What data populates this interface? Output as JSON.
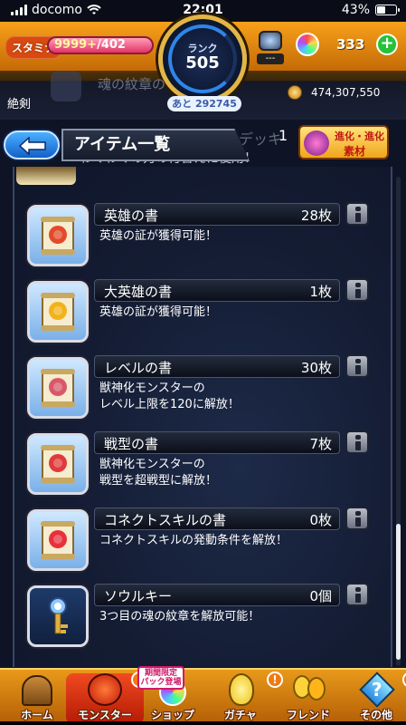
{
  "status_bar": {
    "carrier": "docomo",
    "time": "22:01",
    "battery": "43%",
    "battery_level": 0.43
  },
  "header": {
    "stamina_label": "スタミナ",
    "stamina_current": "9999+",
    "stamina_max": "/402",
    "rank_label": "ランク",
    "rank_value": "505",
    "rank_next": "あと 292745",
    "item_slot_label": "---",
    "orb_count": "333",
    "plus_label": "+",
    "title_left": "絶剣",
    "gold": "474,307,550",
    "faded_text": "魂の紋章の"
  },
  "banner": {
    "title": "アイテム一覧",
    "behind_text": "ワクワクデッキ",
    "behind_subtext": "わくわくの力の付替えに使用！",
    "behind_count": "1",
    "evo_line1": "進化・進化",
    "evo_line2": "素材"
  },
  "items": [
    {
      "name": "英雄の書",
      "count": "28枚",
      "description": "英雄の証が獲得可能！",
      "icon": "scroll-hero-icon",
      "color": "#e24a2a"
    },
    {
      "name": "大英雄の書",
      "count": "1枚",
      "description": "英雄の証が獲得可能！",
      "icon": "scroll-great-hero-icon",
      "color": "#f2b21a"
    },
    {
      "name": "レベルの書",
      "count": "30枚",
      "description": "獣神化モンスターの\nレベル上限を120に解放！",
      "icon": "scroll-level-icon",
      "color": "#d8586a"
    },
    {
      "name": "戦型の書",
      "count": "7枚",
      "description": "獣神化モンスターの\n戦型を超戦型に解放！",
      "icon": "scroll-battle-type-icon",
      "color": "#e03a3a"
    },
    {
      "name": "コネクトスキルの書",
      "count": "0枚",
      "description": "コネクトスキルの発動条件を解放！",
      "icon": "scroll-connect-skill-icon",
      "color": "#e8303a"
    },
    {
      "name": "ソウルキー",
      "count": "0個",
      "description": "3つ目の魂の紋章を解放可能！",
      "icon": "soul-key-icon",
      "color": "#8ec8ff"
    }
  ],
  "bottom_nav": [
    {
      "label": "ホーム",
      "icon": "home-icon",
      "alert": ""
    },
    {
      "label": "モンスター",
      "icon": "monster-icon",
      "alert": "!"
    },
    {
      "label": "ショップ",
      "icon": "shop-orb-icon",
      "alert": ""
    },
    {
      "label": "ガチャ",
      "icon": "gacha-egg-icon",
      "alert": "!"
    },
    {
      "label": "フレンド",
      "icon": "friend-balloon-icon",
      "alert": ""
    },
    {
      "label": "その他",
      "icon": "other-icon",
      "alert": "!"
    }
  ],
  "promo_badge": {
    "line1": "期間限定",
    "line2": "パック登場"
  },
  "scroll_position": 0.78
}
